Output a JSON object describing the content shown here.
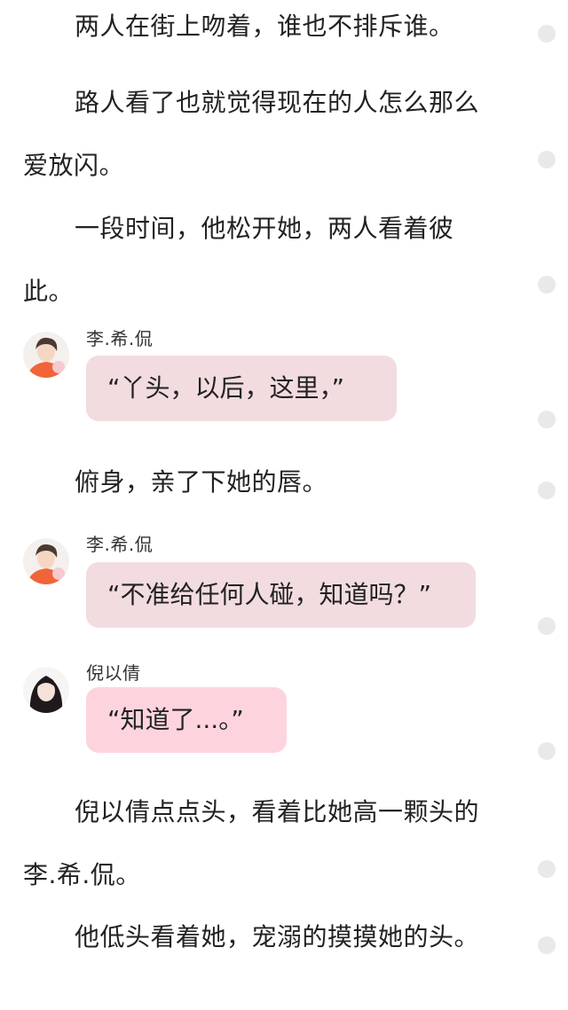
{
  "paragraphs": [
    "两人在街上吻着，谁也不排斥谁。",
    "路人看了也就觉得现在的人怎么那么爱放闪。",
    "一段时间，他松开她，两人看着彼此。",
    "俯身，亲了下她的唇。",
    "倪以倩点点头，看着比她高一颗头的李.希.侃。",
    "他低头看着她，宠溺的摸摸她的头。"
  ],
  "dialogues": [
    {
      "speaker": "李.希.侃",
      "text": "“丫头，以后，这里，”"
    },
    {
      "speaker": "李.希.侃",
      "text": "“不准给任何人碰，知道吗？”"
    },
    {
      "speaker": "倪以倩",
      "text": "“知道了...。”"
    }
  ],
  "colors": {
    "male_bubble": "#f2dcdf",
    "female_bubble": "#fdd4de",
    "side_dot": "#e9e9e9"
  }
}
